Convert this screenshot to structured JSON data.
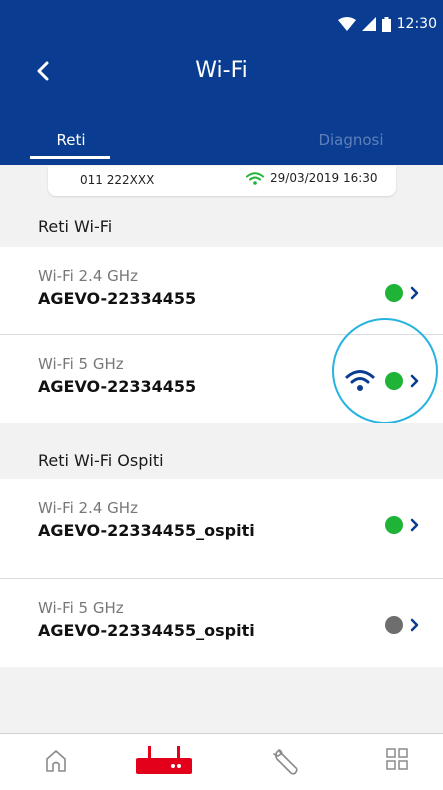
{
  "status_bar": {
    "time": "12:30"
  },
  "header": {
    "title": "Wi-Fi"
  },
  "tabs": [
    {
      "label": "Reti",
      "active": true
    },
    {
      "label": "Diagnosi",
      "active": false
    }
  ],
  "info": {
    "number": "011 222XXX",
    "datetime": "29/03/2019 16:30"
  },
  "sections": [
    {
      "title": "Reti Wi-Fi",
      "items": [
        {
          "band": "Wi-Fi 2.4 GHz",
          "ssid": "AGEVO-22334455",
          "status": "green"
        },
        {
          "band": "Wi-Fi 5 GHz",
          "ssid": "AGEVO-22334455",
          "status": "green",
          "connected_icon": "wifi-icon"
        }
      ]
    },
    {
      "title": "Reti Wi-Fi Ospiti",
      "items": [
        {
          "band": "Wi-Fi 2.4 GHz",
          "ssid": "AGEVO-22334455_ospiti",
          "status": "green"
        },
        {
          "band": "Wi-Fi 5 GHz",
          "ssid": "AGEVO-22334455_ospiti",
          "status": "gray"
        }
      ]
    }
  ],
  "bottom_nav": [
    {
      "icon": "home-icon",
      "active": false
    },
    {
      "icon": "router-icon",
      "active": true
    },
    {
      "icon": "wrench-icon",
      "active": false
    },
    {
      "icon": "grid-icon",
      "active": false
    }
  ],
  "colors": {
    "header": "#0a3d91",
    "status_green": "#1fb437",
    "status_gray": "#6e6e6e",
    "wifi_icon_blue": "#0a3d91",
    "highlight": "#27b3e0",
    "nav_active": "#e2001a"
  }
}
